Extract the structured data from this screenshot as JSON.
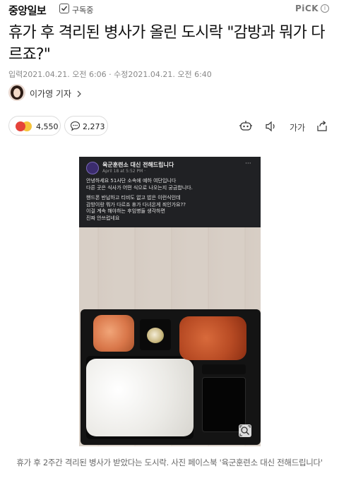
{
  "header": {
    "logo": "중앙일보",
    "subscribe_label": "구독중",
    "pick_label": "PiCK",
    "info_icon": "i"
  },
  "article": {
    "headline": "휴가 후 격리된 병사가 올린 도시락 \"감방과 뭐가 다르죠?\"",
    "published": "입력2021.04.21. 오전 6:06",
    "modified": "수정2021.04.21. 오전 6:40",
    "author": "이가영 기자"
  },
  "reactions": {
    "reaction_count": "4,550",
    "comment_count": "2,273",
    "font_size_label": "가가"
  },
  "photo_post": {
    "page_name": "육군훈련소 대신 전해드립니다",
    "date": "April 18 at 5:52 PM · ",
    "more": "···",
    "lines": [
      "안녕하세요 51사단 소속에 예하 여단입니다",
      "다른 곳은 식사가 어떤 식으로 나오는지 궁금합니다.",
      "핸드폰 반납하고 티비도 없고 밥은 이런식인데",
      "감방이랑 뭐가 다르죠 휴가 다녀온게 죄인가요??",
      "이걸 계속 해야하는 후임병들 생각하면",
      "진짜 안쓰럽네요"
    ]
  },
  "caption": "휴가 후 2주간 격리된 병사가 받았다는 도시락. 사진 페이스북 '육군훈련소 대신 전해드립니다'",
  "colors": {
    "angry": "#e5433a",
    "sad": "#f6c33b",
    "muted_text": "#888888"
  },
  "icons": [
    "check-icon",
    "info-icon",
    "chevron-right-icon",
    "angry-emoji-icon",
    "sad-emoji-icon",
    "comment-icon",
    "robot-summary-icon",
    "speaker-icon",
    "font-size-icon",
    "share-icon",
    "zoom-icon"
  ]
}
